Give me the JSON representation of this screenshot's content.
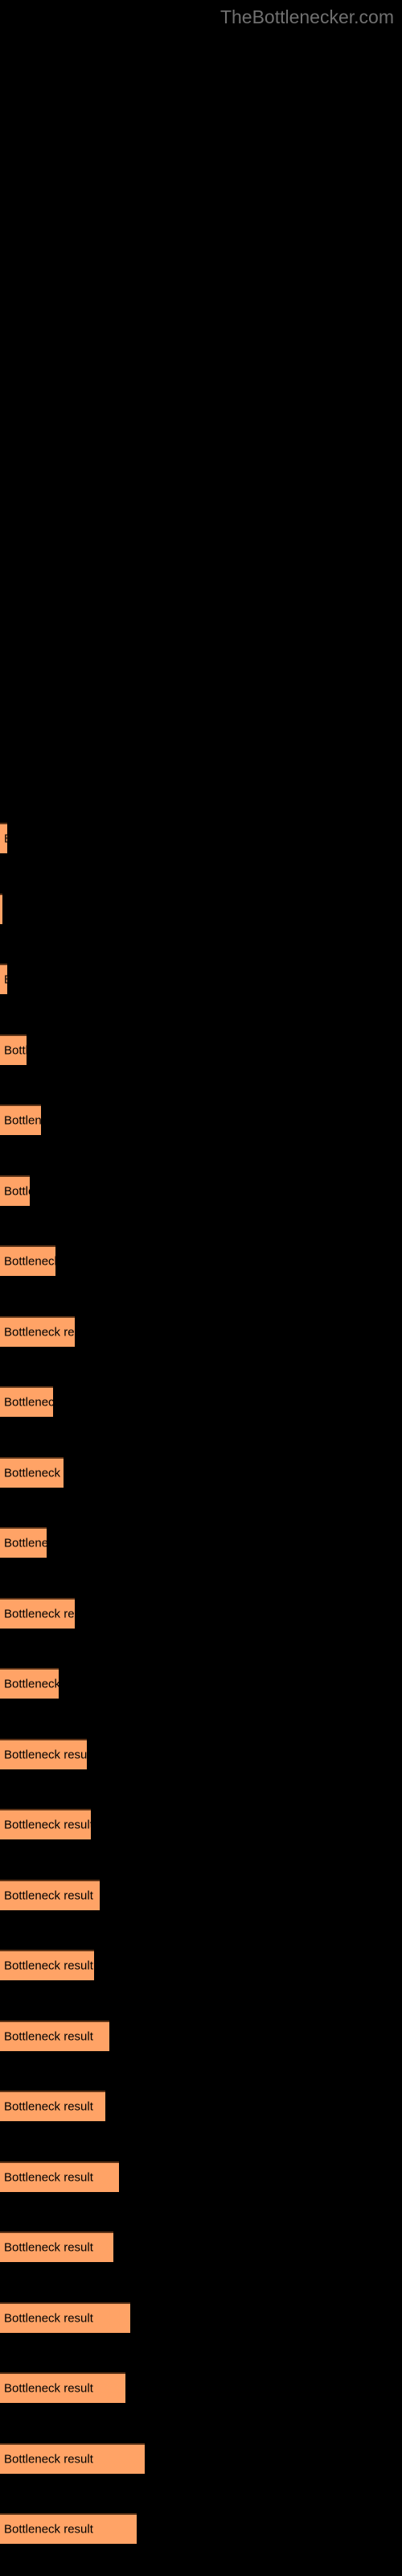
{
  "header": {
    "site_title": "TheBottlenecker.com"
  },
  "colors": {
    "background": "#000000",
    "bar_fill": "#ffa366",
    "bar_border_top": "#5c3317",
    "bar_label_text": "#000000",
    "title_text": "#707070"
  },
  "chart_data": {
    "type": "bar",
    "orientation": "horizontal",
    "title": "TheBottlenecker.com",
    "xlabel": "",
    "ylabel": "",
    "grid": false,
    "legend": false,
    "bar_label_text": "Bottleneck result",
    "xlim": [
      0,
      500
    ],
    "categories": [
      "Bottleneck result",
      "Bottleneck result",
      "Bottleneck result",
      "Bottleneck result",
      "Bottleneck result",
      "Bottleneck result",
      "Bottleneck result",
      "Bottleneck result",
      "Bottleneck result",
      "Bottleneck result",
      "Bottleneck result",
      "Bottleneck result",
      "Bottleneck result",
      "Bottleneck result",
      "Bottleneck result",
      "Bottleneck result",
      "Bottleneck result",
      "Bottleneck result",
      "Bottleneck result",
      "Bottleneck result",
      "Bottleneck result",
      "Bottleneck result",
      "Bottleneck result",
      "Bottleneck result",
      "Bottleneck result"
    ],
    "values": [
      9,
      3,
      9,
      33,
      51,
      37,
      69,
      93,
      66,
      79,
      58,
      93,
      73,
      108,
      113,
      124,
      117,
      136,
      131,
      148,
      141,
      162,
      156,
      180,
      170
    ],
    "bars": [
      {
        "y": 1022,
        "width": 9,
        "label": "Bottleneck result"
      },
      {
        "y": 1110,
        "width": 3,
        "label": "Bottleneck result"
      },
      {
        "y": 1197,
        "width": 9,
        "label": "Bottleneck result"
      },
      {
        "y": 1285,
        "width": 33,
        "label": "Bottleneck result"
      },
      {
        "y": 1372,
        "width": 51,
        "label": "Bottleneck result"
      },
      {
        "y": 1460,
        "width": 37,
        "label": "Bottleneck result"
      },
      {
        "y": 1547,
        "width": 69,
        "label": "Bottleneck result"
      },
      {
        "y": 1635,
        "width": 93,
        "label": "Bottleneck result"
      },
      {
        "y": 1722,
        "width": 66,
        "label": "Bottleneck result"
      },
      {
        "y": 1810,
        "width": 79,
        "label": "Bottleneck result"
      },
      {
        "y": 1897,
        "width": 58,
        "label": "Bottleneck result"
      },
      {
        "y": 1985,
        "width": 93,
        "label": "Bottleneck result"
      },
      {
        "y": 2072,
        "width": 73,
        "label": "Bottleneck result"
      },
      {
        "y": 2160,
        "width": 108,
        "label": "Bottleneck result"
      },
      {
        "y": 2247,
        "width": 113,
        "label": "Bottleneck result"
      },
      {
        "y": 2335,
        "width": 124,
        "label": "Bottleneck result"
      },
      {
        "y": 2422,
        "width": 117,
        "label": "Bottleneck result"
      },
      {
        "y": 2510,
        "width": 136,
        "label": "Bottleneck result"
      },
      {
        "y": 2597,
        "width": 131,
        "label": "Bottleneck result"
      },
      {
        "y": 2685,
        "width": 148,
        "label": "Bottleneck result"
      },
      {
        "y": 2772,
        "width": 141,
        "label": "Bottleneck result"
      },
      {
        "y": 2860,
        "width": 162,
        "label": "Bottleneck result"
      },
      {
        "y": 2947,
        "width": 156,
        "label": "Bottleneck result"
      },
      {
        "y": 3035,
        "width": 180,
        "label": "Bottleneck result"
      },
      {
        "y": 3122,
        "width": 170,
        "label": "Bottleneck result"
      }
    ]
  }
}
